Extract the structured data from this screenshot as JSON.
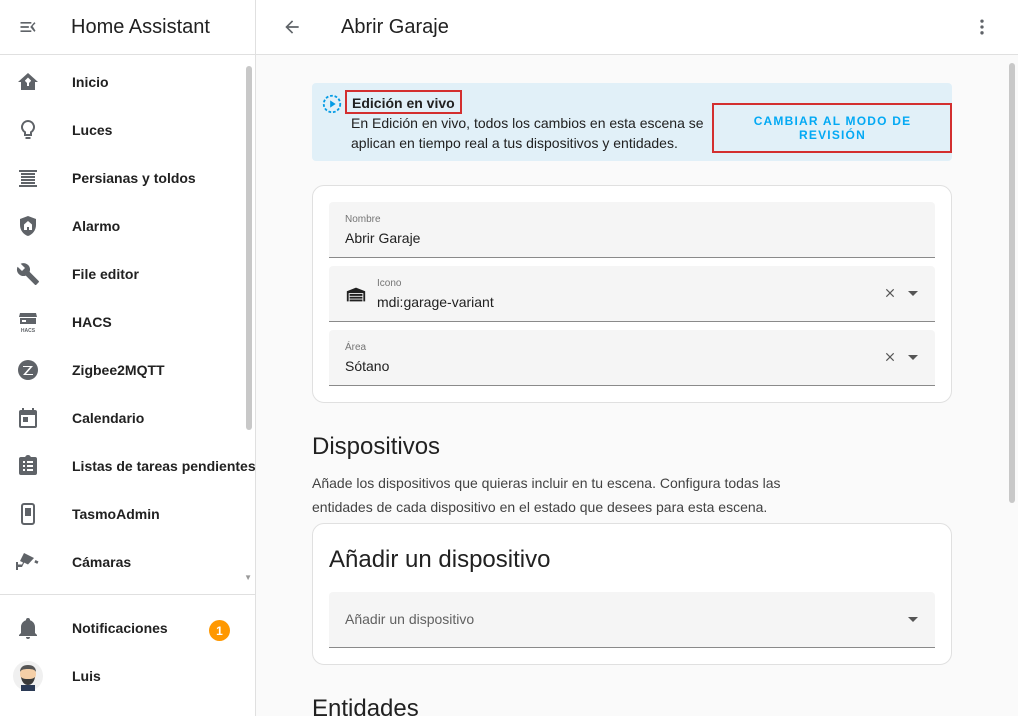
{
  "app": {
    "title": "Home Assistant"
  },
  "sidebar": {
    "items": [
      {
        "label": "Inicio",
        "icon": "home-icon"
      },
      {
        "label": "Luces",
        "icon": "lightbulb-icon"
      },
      {
        "label": "Persianas y toldos",
        "icon": "blinds-icon"
      },
      {
        "label": "Alarmo",
        "icon": "shield-home-icon"
      },
      {
        "label": "File editor",
        "icon": "wrench-icon"
      },
      {
        "label": "HACS",
        "icon": "hacs-icon"
      },
      {
        "label": "Zigbee2MQTT",
        "icon": "zigbee-icon"
      },
      {
        "label": "Calendario",
        "icon": "calendar-icon"
      },
      {
        "label": "Listas de tareas pendientes",
        "icon": "clipboard-list-icon"
      },
      {
        "label": "TasmoAdmin",
        "icon": "tasmota-icon"
      },
      {
        "label": "Cámaras",
        "icon": "cctv-icon"
      }
    ],
    "notifications": {
      "label": "Notificaciones",
      "count": "1"
    },
    "user": {
      "label": "Luis"
    }
  },
  "topbar": {
    "title": "Abrir Garaje"
  },
  "alert": {
    "title": "Edición en vivo",
    "text": "En Edición en vivo, todos los cambios en esta escena se aplican en tiempo real a tus dispositivos y entidades.",
    "action": "CAMBIAR AL MODO DE REVISIÓN"
  },
  "form": {
    "name": {
      "label": "Nombre",
      "value": "Abrir Garaje"
    },
    "icon": {
      "label": "Icono",
      "value": "mdi:garage-variant"
    },
    "area": {
      "label": "Área",
      "value": "Sótano"
    }
  },
  "devices": {
    "title": "Dispositivos",
    "description": "Añade los dispositivos que quieras incluir en tu escena. Configura todas las entidades de cada dispositivo en el estado que desees para esta escena.",
    "card_title": "Añadir un dispositivo",
    "picker_label": "Añadir un dispositivo"
  },
  "entities": {
    "title": "Entidades"
  }
}
